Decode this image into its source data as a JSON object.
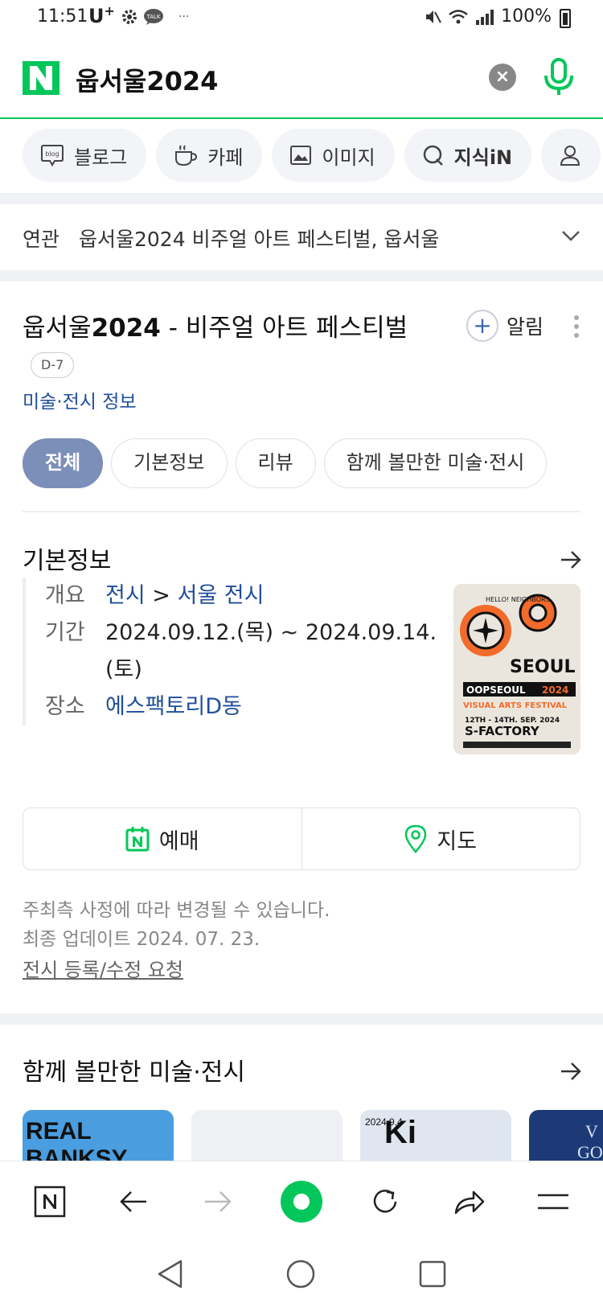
{
  "status_bar": {
    "time": "11:51",
    "carrier": "U",
    "carrier_sup": "+",
    "misc": "···",
    "battery": "100%"
  },
  "search": {
    "query": "웁서울2024",
    "clear_label": "×"
  },
  "tabs": [
    {
      "label": "블로그",
      "icon": "blog-icon"
    },
    {
      "label": "카페",
      "icon": "cafe-cup-icon"
    },
    {
      "label": "이미지",
      "icon": "image-icon"
    },
    {
      "label": "지식iN",
      "icon": "kin-icon"
    },
    {
      "label": "",
      "icon": "person-icon"
    }
  ],
  "related": {
    "label": "연관",
    "text": "웁서울2024 비주얼 아트 페스티벌, 웁서울"
  },
  "card": {
    "title_prefix": "웁서울",
    "title_year": "2024",
    "title_rest": " - 비주얼 아트 페스티벌",
    "dday": "D-7",
    "category": "미술·전시 정보",
    "alarm_label": "알림",
    "subtabs": [
      "전체",
      "기본정보",
      "리뷰",
      "함께 볼만한 미술·전시"
    ],
    "section_title": "기본정보",
    "info": {
      "overview_key": "개요",
      "overview_cat1": "전시",
      "overview_sep": " > ",
      "overview_cat2": "서울 전시",
      "period_key": "기간",
      "period_value": "2024.09.12.(목) ~ 2024.09.14.(토)",
      "venue_key": "장소",
      "venue_value": "에스팩토리D동"
    },
    "poster": {
      "top_text": "HELLO! NEIGHBORS",
      "seoul": "SEOUL",
      "oop": "OOPSEOUL",
      "year": "2024",
      "festival": "VISUAL ARTS FESTIVAL",
      "dates": "12TH - 14TH. SEP. 2024",
      "venue": "S-FACTORY"
    },
    "buttons": {
      "booking": "예매",
      "map": "지도"
    },
    "note_line1": "주최측 사정에 따라 변경될 수 있습니다.",
    "note_line2": "최종 업데이트 2024. 07. 23.",
    "request_link": "전시 등록/수정 요청"
  },
  "related_exhibitions": {
    "title": "함께 볼만한 미술·전시",
    "thumbs": [
      {
        "text1": "REAL",
        "text2": "BANKSY",
        "color": "#4a9ee0"
      },
      {
        "text1": "",
        "text2": "",
        "color": "#eef0f3"
      },
      {
        "text1": "Ki",
        "text2": "2024.9.4",
        "color": "#dfe6f0"
      },
      {
        "text1": "V",
        "text2": "GO",
        "color": "#1d3a78"
      }
    ]
  },
  "colors": {
    "naver_green": "#03c75a",
    "link_blue": "#1f4e9b",
    "active_chip": "#7c8fb8"
  }
}
